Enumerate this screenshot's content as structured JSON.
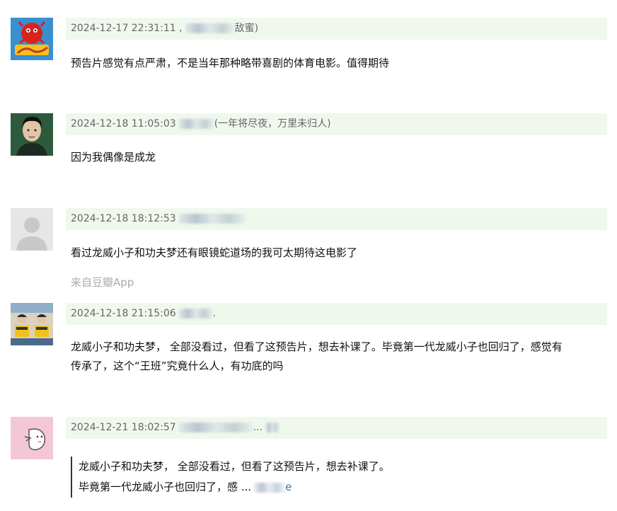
{
  "comments": [
    {
      "avatar": "scanners-logo-avatar",
      "timestamp": "2024-12-17 22:31:11",
      "user_prefix": ",",
      "user_suffix": "敌蜜)",
      "text": "预告片感觉有点严肃，不是当年那种略带喜剧的体育电影。值得期待"
    },
    {
      "avatar": "young-man-portrait-avatar",
      "timestamp": "2024-12-18 11:05:03",
      "user_prefix": "",
      "user_suffix": "(一年将尽夜，万里未归人)",
      "text": "因为我偶像是成龙"
    },
    {
      "avatar": "default-user-avatar",
      "timestamp": "2024-12-18 18:12:53",
      "user_prefix": "",
      "user_suffix": "",
      "text": "看过龙威小子和功夫梦还有眼镜蛇道场的我可太期待这电影了",
      "source": "来自豆瓣App"
    },
    {
      "avatar": "kids-photo-avatar",
      "timestamp": "2024-12-18 21:15:06",
      "user_prefix": "",
      "user_suffix": ".",
      "text_lines": [
        "龙威小子和功夫梦， 全部没看过，但看了这预告片，想去补课了。毕竟第一代龙威小子也回归了，感觉有",
        "传承了，这个“王班”究竟什么人，有功底的吗"
      ]
    },
    {
      "avatar": "pink-cartoon-avatar",
      "timestamp": "2024-12-21 18:02:57",
      "user_prefix": "",
      "user_suffix": "...",
      "quote_lines": [
        "龙威小子和功夫梦， 全部没看过，但看了这预告片，想去补课了。",
        "毕竟第一代龙威小子也回归了，感 ..."
      ],
      "quote_expand": "e"
    }
  ]
}
